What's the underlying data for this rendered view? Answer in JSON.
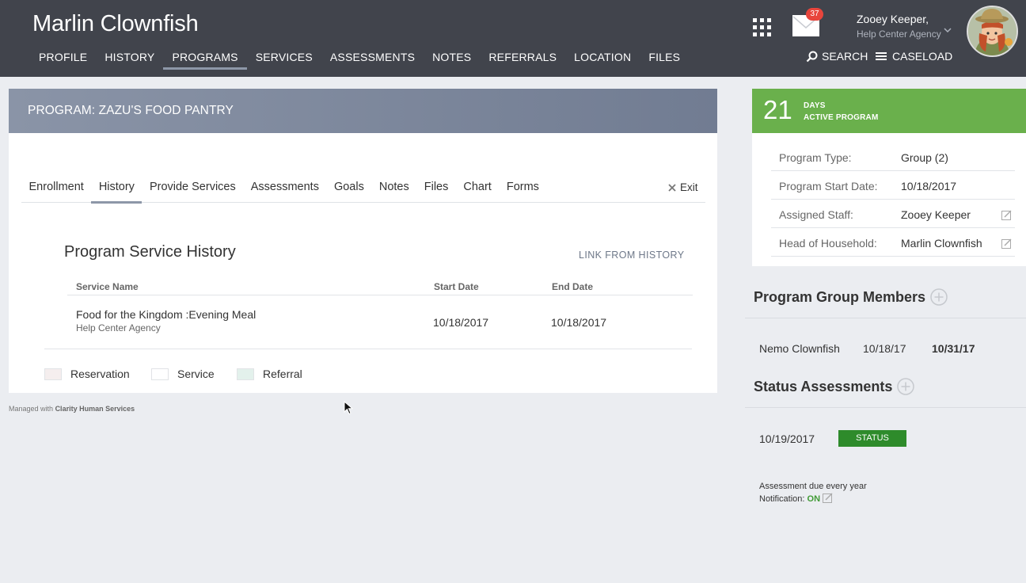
{
  "header": {
    "client_name": "Marlin Clownfish",
    "nav": [
      "PROFILE",
      "HISTORY",
      "PROGRAMS",
      "SERVICES",
      "ASSESSMENTS",
      "NOTES",
      "REFERRALS",
      "LOCATION",
      "FILES"
    ],
    "active_nav": "PROGRAMS",
    "mail_count": "37",
    "user_name": "Zooey Keeper,",
    "user_agency": "Help Center Agency",
    "search_label": "SEARCH",
    "caseload_label": "CASELOAD"
  },
  "program": {
    "title": "PROGRAM: ZAZU'S FOOD PANTRY",
    "tabs": [
      "Enrollment",
      "History",
      "Provide Services",
      "Assessments",
      "Goals",
      "Notes",
      "Files",
      "Chart",
      "Forms"
    ],
    "active_tab": "History",
    "exit_label": "Exit",
    "section_title": "Program Service History",
    "link_from_history": "LINK FROM HISTORY",
    "columns": {
      "service_name": "Service Name",
      "start_date": "Start Date",
      "end_date": "End Date"
    },
    "rows": [
      {
        "service": "Food for the Kingdom :Evening Meal",
        "agency": "Help Center Agency",
        "start": "10/18/2017",
        "end": "10/18/2017"
      }
    ],
    "legend": [
      {
        "label": "Reservation",
        "color": "#f5eeee"
      },
      {
        "label": "Service",
        "color": "#ffffff"
      },
      {
        "label": "Referral",
        "color": "#e3f1ec"
      }
    ]
  },
  "footer": {
    "prefix": "Managed with",
    "brand": "Clarity Human Services"
  },
  "sidebar": {
    "days_count": "21",
    "days_label_1": "DAYS",
    "days_label_2": "ACTIVE PROGRAM",
    "info": [
      {
        "label": "Program Type:",
        "value": "Group (2)",
        "editable": false
      },
      {
        "label": "Program Start Date:",
        "value": "10/18/2017",
        "editable": false
      },
      {
        "label": "Assigned Staff:",
        "value": "Zooey Keeper",
        "editable": true
      },
      {
        "label": "Head of Household:",
        "value": "Marlin Clownfish",
        "editable": true
      }
    ],
    "group_members_title": "Program Group Members",
    "members": [
      {
        "name": "Nemo Clownfish",
        "start": "10/18/17",
        "end": "10/31/17"
      }
    ],
    "status_title": "Status Assessments",
    "assessment_date": "10/19/2017",
    "status_label": "STATUS",
    "assessment_due": "Assessment due every year",
    "notification_label": "Notification:",
    "notification_value": "ON"
  },
  "colors": {
    "topbar": "#41444c",
    "days_green": "#6ab04c",
    "status_green": "#2e8b2b",
    "accent": "#8d97a8"
  }
}
